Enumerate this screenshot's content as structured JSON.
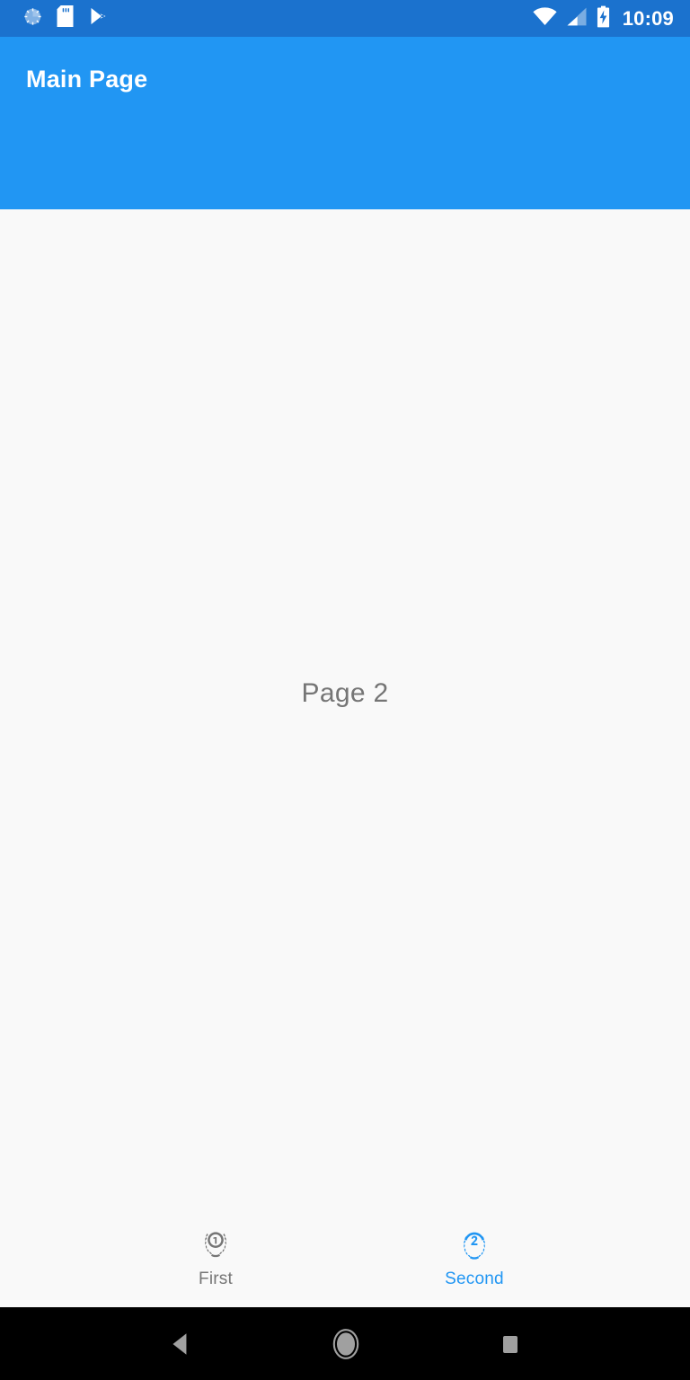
{
  "status_bar": {
    "background_color": "#1B72CE",
    "time": "10:09",
    "left_icons": [
      {
        "name": "screen-record-circle-icon",
        "label": "Screen recorder"
      },
      {
        "name": "sd-card-icon",
        "label": "SD card"
      },
      {
        "name": "play-store-icon",
        "label": "Google Play"
      }
    ],
    "right_icons": [
      {
        "name": "wifi-icon",
        "label": "Wi-Fi full signal"
      },
      {
        "name": "cellular-signal-icon",
        "label": "Cellular signal 2 of 4 bars"
      },
      {
        "name": "battery-charging-icon",
        "label": "Battery charging"
      }
    ]
  },
  "app_bar": {
    "title": "Main Page",
    "background_color": "#2196F3",
    "title_color": "#FFFFFF"
  },
  "content": {
    "page_text": "Page 2",
    "text_color": "#757575",
    "background_color": "#F9F9F9"
  },
  "bottom_nav": {
    "active_color": "#2196F3",
    "inactive_color": "#757575",
    "items": [
      {
        "label": "First",
        "icon": "wreath-one-icon",
        "active": false
      },
      {
        "label": "Second",
        "icon": "wreath-two-icon",
        "active": true
      }
    ]
  },
  "system_nav": {
    "background_color": "#000000",
    "icon_color": "#A0A0A0",
    "buttons": [
      {
        "name": "back-button",
        "icon": "triangle-back-icon"
      },
      {
        "name": "home-button",
        "icon": "circle-home-icon"
      },
      {
        "name": "recents-button",
        "icon": "square-recents-icon"
      }
    ]
  }
}
